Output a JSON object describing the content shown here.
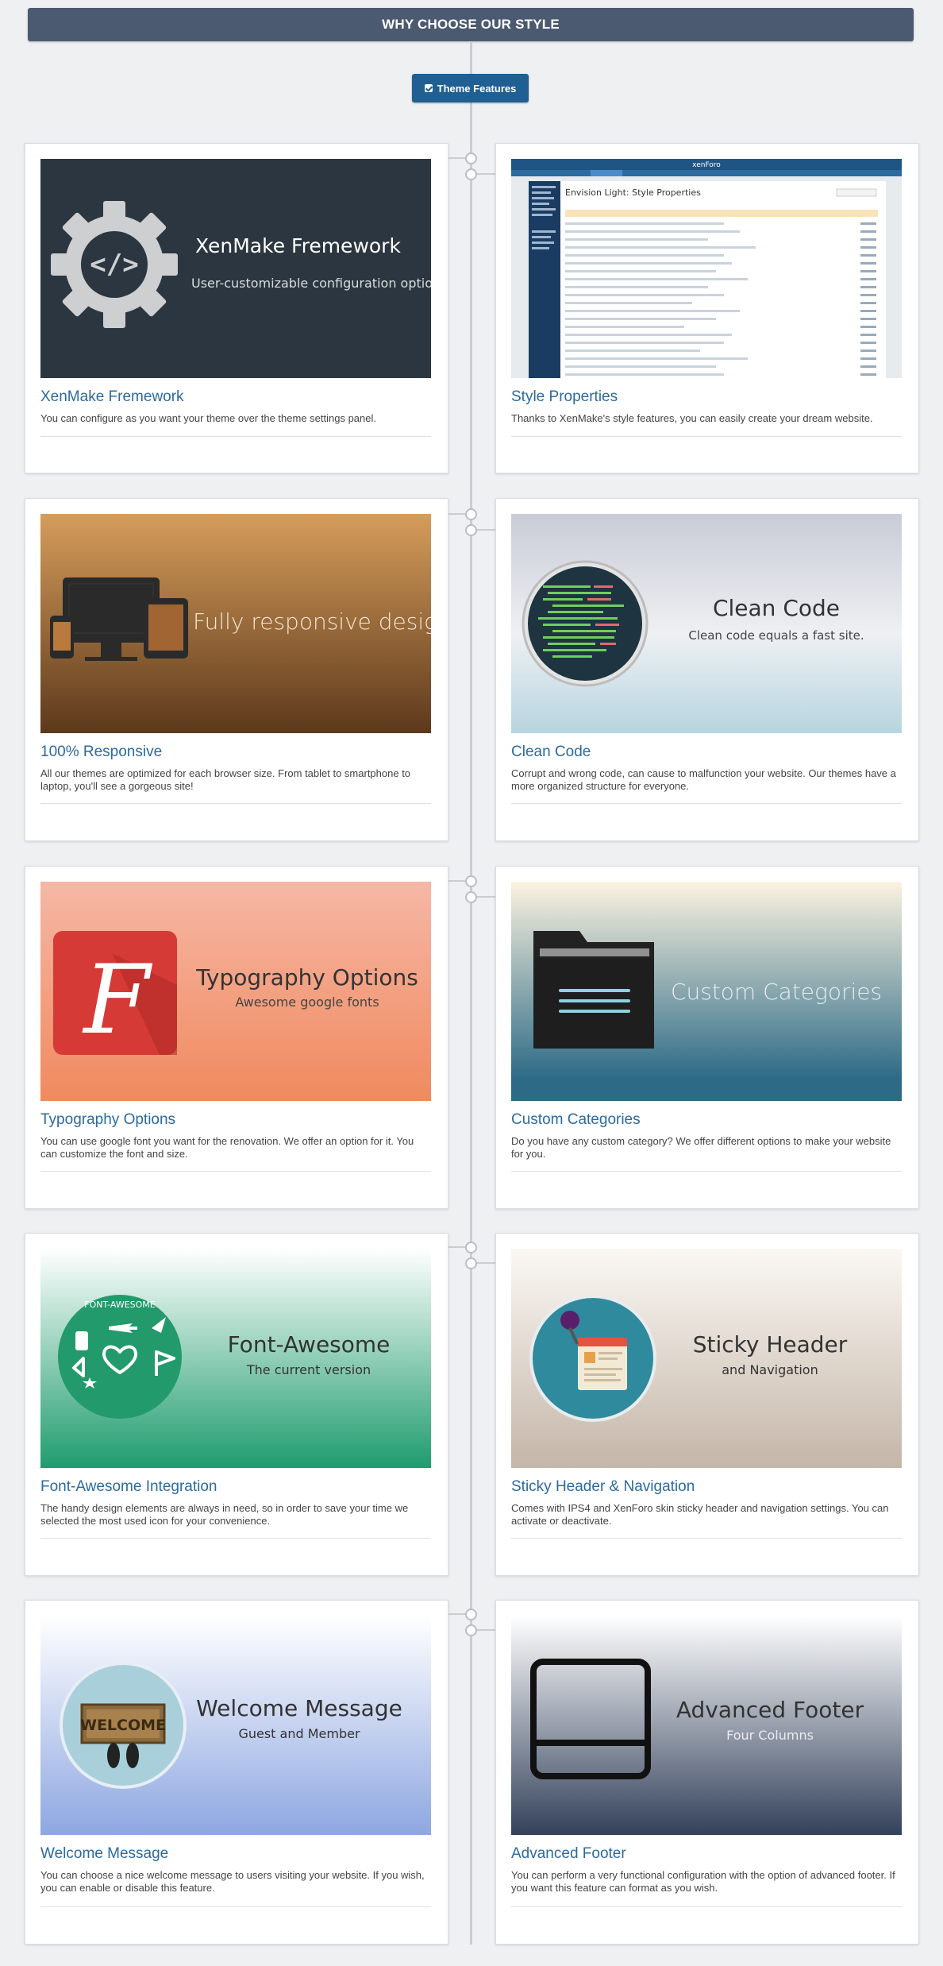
{
  "header": {
    "title": "WHY CHOOSE OUR STYLE"
  },
  "button": {
    "label": "Theme Features"
  },
  "cards": [
    {
      "title": "XenMake Fremework",
      "desc": "You can configure as you want your theme over the theme settings panel.",
      "img_title": "XenMake Fremework",
      "img_sub": "User-customizable configuration options.",
      "icon": "gear-code-icon"
    },
    {
      "title": "Style Properties",
      "desc": "Thanks to  XenMake's  style features, you can easily create your dream website.",
      "img_title": "Envision Light: Style Properties",
      "img_sub": "",
      "icon": "screenshot-style-properties"
    },
    {
      "title": "100% Responsive",
      "desc": "All our themes are optimized for each browser size. From tablet to smartphone to laptop, you'll see a gorgeous site!",
      "img_title": "Fully responsive design",
      "img_sub": "",
      "icon": "devices-icon"
    },
    {
      "title": "Clean Code",
      "desc": "Corrupt and wrong code, can cause to malfunction your website. Our themes have a more organized structure for everyone.",
      "img_title": "Clean Code",
      "img_sub": "Clean code equals a fast site.",
      "icon": "code-circle-icon"
    },
    {
      "title": "Typography Options",
      "desc": "You can use google font you want for the renovation. We offer an option for it. You can customize the font and size.",
      "img_title": "Typography Options",
      "img_sub": "Awesome google fonts",
      "icon": "font-f-icon"
    },
    {
      "title": "Custom Categories",
      "desc": "Do you have any custom category? We offer different options to make your website for you.",
      "img_title": "Custom Categories",
      "img_sub": "",
      "icon": "folder-icon"
    },
    {
      "title": "Font-Awesome Integration",
      "desc": "The handy design elements are always in need, so in order to save your time we selected the most used icon for your convenience.",
      "img_title": "Font-Awesome",
      "img_sub": "The current version",
      "img_badge": "FONT-AWESOME",
      "icon": "font-awesome-badge-icon"
    },
    {
      "title": "Sticky Header & Navigation",
      "desc": "Comes with IPS4 and XenForo skin sticky header and navigation settings. You can activate or deactivate.",
      "img_title": "Sticky Header",
      "img_sub": "and Navigation",
      "icon": "pin-browser-icon"
    },
    {
      "title": "Welcome Message",
      "desc": "You can choose a nice welcome message to users visiting your website. If you wish, you can enable or disable this feature.",
      "img_title": "Welcome Message",
      "img_sub": "Guest and Member",
      "img_badge": "WELCOME",
      "icon": "welcome-mat-icon"
    },
    {
      "title": "Advanced Footer",
      "desc": "You can perform a very functional configuration with the option of advanced footer. If you want this feature can format as you wish.",
      "img_title": "Advanced Footer",
      "img_sub": "Four Columns",
      "icon": "footer-layout-icon"
    }
  ]
}
